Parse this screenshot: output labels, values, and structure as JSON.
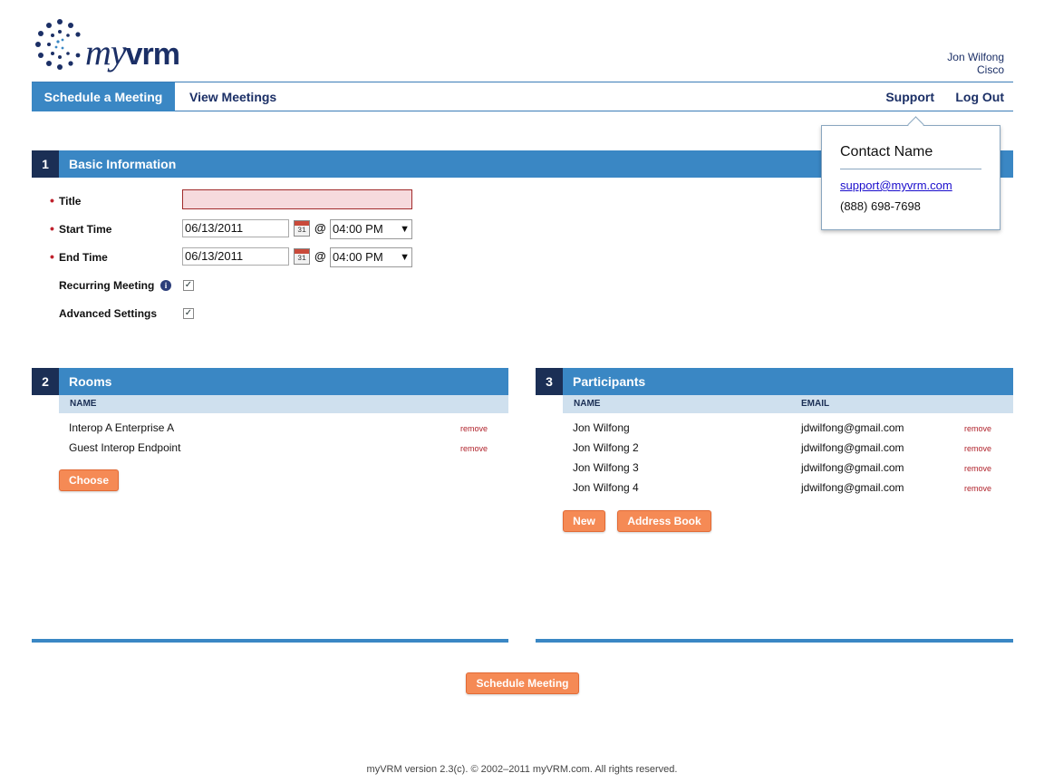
{
  "brand": {
    "logo_text": "myvrm"
  },
  "user": {
    "name": "Jon Wilfong",
    "org": "Cisco"
  },
  "nav": {
    "schedule": "Schedule a Meeting",
    "view": "View Meetings",
    "support": "Support",
    "logout": "Log Out"
  },
  "popup": {
    "title": "Contact Name",
    "email": "support@myvrm.com",
    "phone": "(888) 698-7698"
  },
  "basic": {
    "num": "1",
    "title": "Basic Information",
    "title_label": "Title",
    "title_value": "",
    "start_label": "Start Time",
    "start_date": "06/13/2011",
    "start_time": "04:00 PM",
    "end_label": "End Time",
    "end_date": "06/13/2011",
    "end_time": "04:00 PM",
    "recurring_label": "Recurring Meeting",
    "recurring_checked": true,
    "advanced_label": "Advanced Settings",
    "advanced_checked": true,
    "at": "@",
    "cal_day": "31",
    "check": "✓",
    "dropdown_arrow": "▼",
    "required_marker": "•",
    "info_glyph": "i"
  },
  "rooms": {
    "num": "2",
    "title": "Rooms",
    "col_name": "NAME",
    "items": [
      {
        "name": "Interop A Enterprise A",
        "action": "remove"
      },
      {
        "name": "Guest Interop Endpoint",
        "action": "remove"
      }
    ],
    "choose_label": "Choose"
  },
  "participants": {
    "num": "3",
    "title": "Participants",
    "col_name": "NAME",
    "col_email": "EMAIL",
    "items": [
      {
        "name": "Jon Wilfong",
        "email": "jdwilfong@gmail.com",
        "action": "remove"
      },
      {
        "name": "Jon Wilfong 2",
        "email": "jdwilfong@gmail.com",
        "action": "remove"
      },
      {
        "name": "Jon Wilfong 3",
        "email": "jdwilfong@gmail.com",
        "action": "remove"
      },
      {
        "name": "Jon Wilfong 4",
        "email": "jdwilfong@gmail.com",
        "action": "remove"
      }
    ],
    "new_label": "New",
    "address_book_label": "Address Book"
  },
  "schedule_button": "Schedule Meeting",
  "footer": "myVRM version 2.3(c). © 2002–2011 myVRM.com. All rights reserved.",
  "colors": {
    "accent": "#3a87c4",
    "dark": "#1b2f55",
    "button": "#f58a55",
    "required": "#c0222d"
  }
}
